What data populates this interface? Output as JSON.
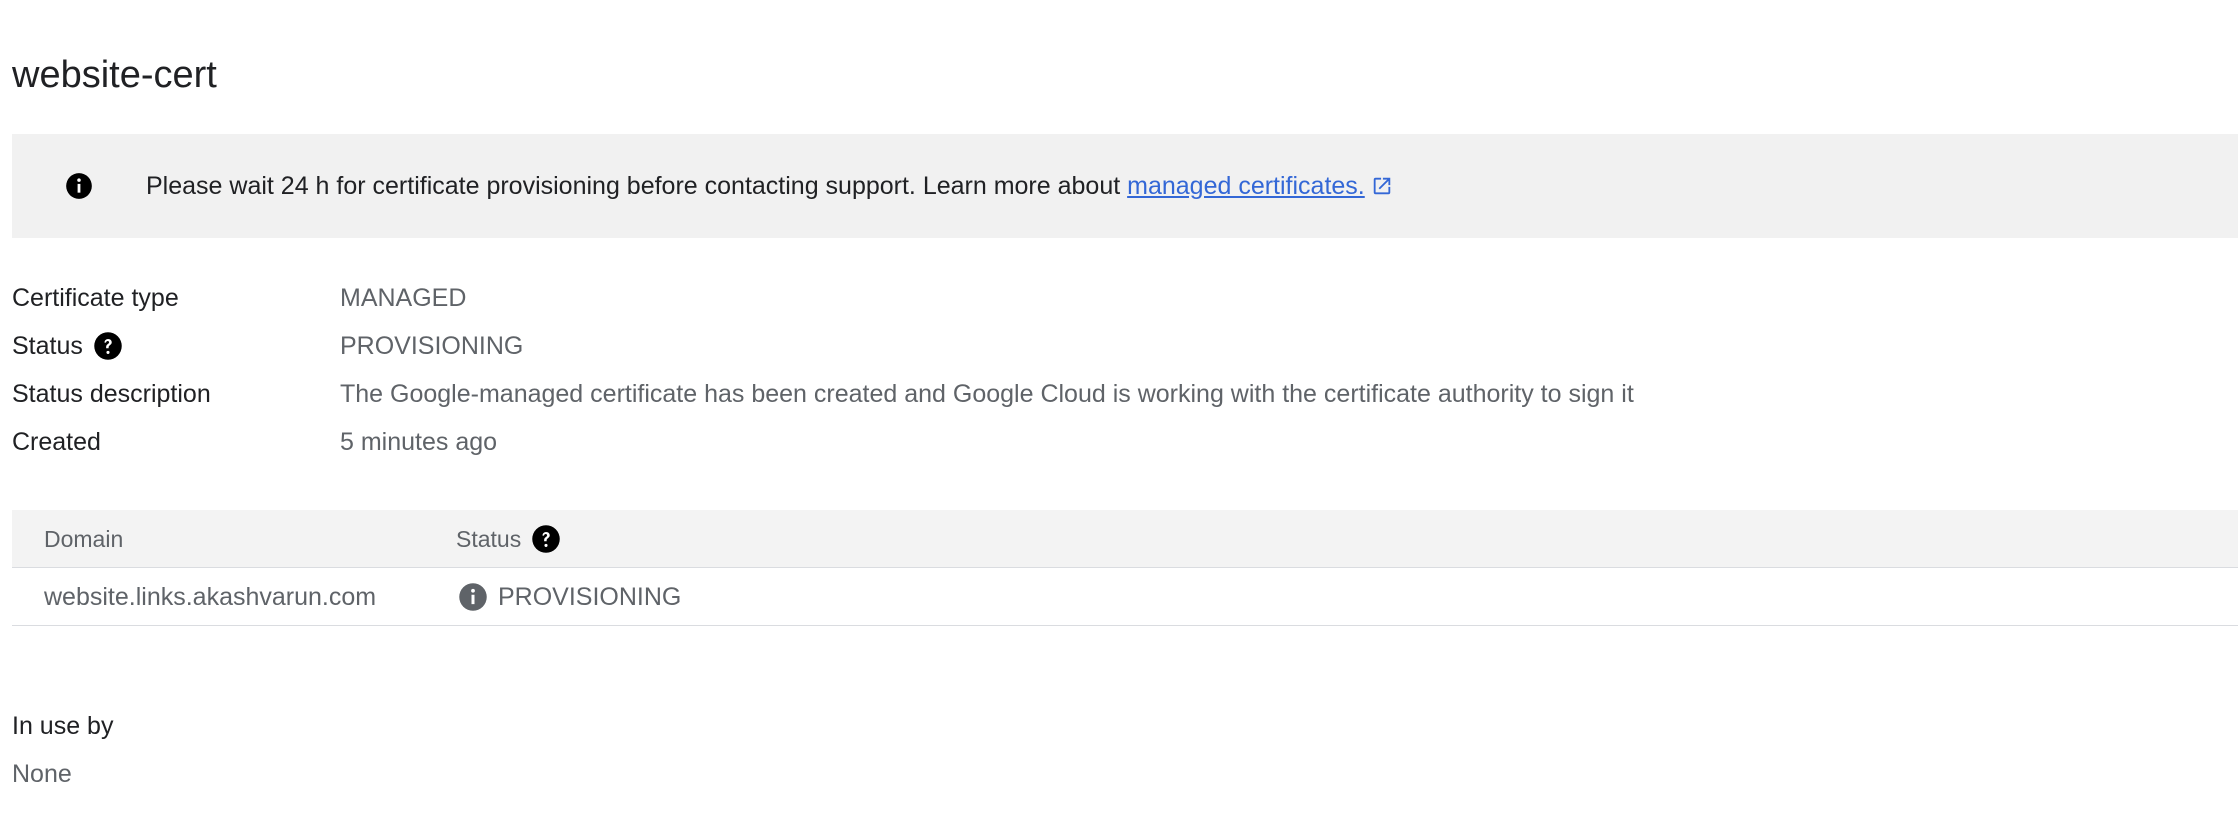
{
  "page": {
    "title": "website-cert"
  },
  "banner": {
    "message": "Please wait 24 h for certificate provisioning before contacting support. Learn more about ",
    "link_text": "managed certificates.",
    "icon": "info-icon",
    "link_icon": "external-link-icon"
  },
  "details": {
    "certificate_type": {
      "label": "Certificate type",
      "value": "MANAGED"
    },
    "status": {
      "label": "Status",
      "value": "PROVISIONING",
      "icon": "help-icon"
    },
    "status_description": {
      "label": "Status description",
      "value": "The Google-managed certificate has been created and Google Cloud is working with the certificate authority to sign it"
    },
    "created": {
      "label": "Created",
      "value": "5 minutes ago"
    }
  },
  "domains_table": {
    "columns": [
      "Domain",
      "Status"
    ],
    "rows": [
      {
        "domain": "website.links.akashvarun.com",
        "status": "PROVISIONING",
        "status_icon": "info-icon"
      }
    ]
  },
  "in_use_by": {
    "label": "In use by",
    "value": "None"
  },
  "colors": {
    "link": "#3367d6",
    "banner_bg": "#f1f1f1",
    "table_header_bg": "#f3f3f3",
    "secondary_text": "#5f6368"
  }
}
